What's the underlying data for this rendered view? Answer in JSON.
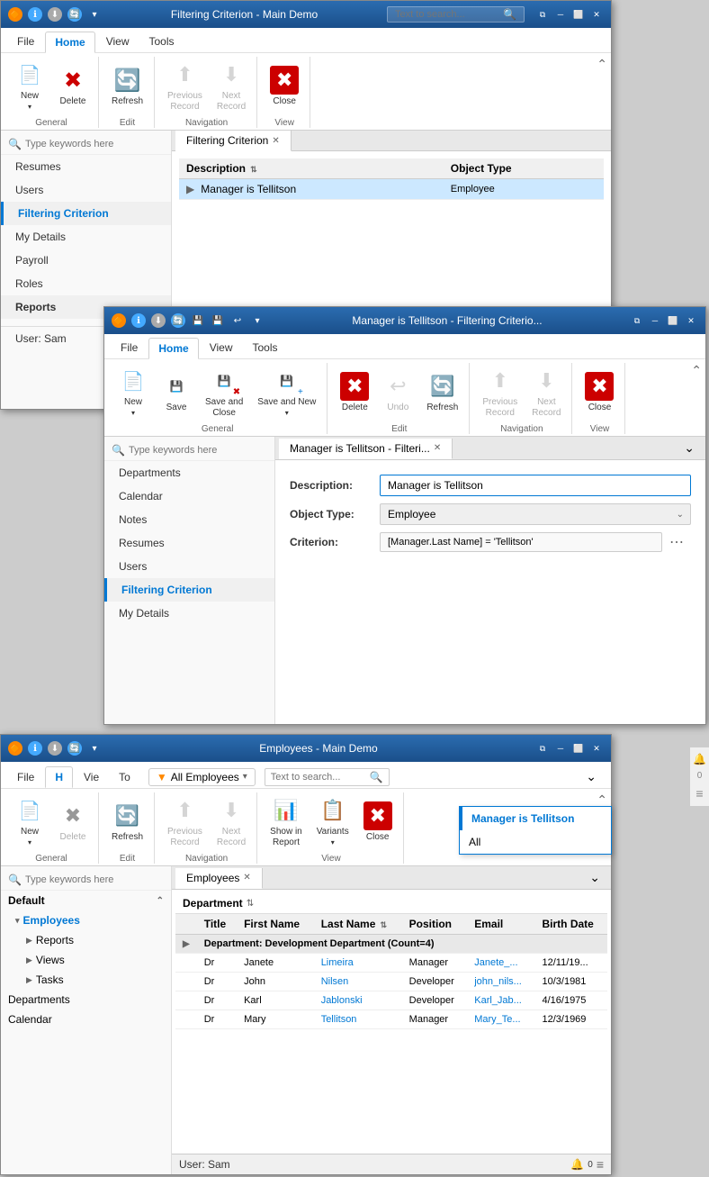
{
  "window1": {
    "title": "Filtering Criterion - Main Demo",
    "menu": [
      "File",
      "Home",
      "View",
      "Tools"
    ],
    "active_menu": "Home",
    "search_placeholder": "Text to search...",
    "ribbon": {
      "groups": [
        {
          "label": "General",
          "items": [
            {
              "id": "new",
              "label": "New",
              "icon": "📄",
              "disabled": false,
              "has_arrow": true
            },
            {
              "id": "delete",
              "label": "Delete",
              "icon": "✖",
              "icon_color": "red",
              "disabled": false
            }
          ]
        },
        {
          "label": "Edit",
          "items": [
            {
              "id": "refresh",
              "label": "Refresh",
              "icon": "🔄",
              "icon_color": "green",
              "disabled": false
            }
          ]
        },
        {
          "label": "Navigation",
          "items": [
            {
              "id": "prev-record",
              "label": "Previous Record",
              "icon": "⬆",
              "disabled": true
            },
            {
              "id": "next-record",
              "label": "Next Record",
              "icon": "⬇",
              "disabled": true
            }
          ]
        },
        {
          "label": "View",
          "items": [
            {
              "id": "close",
              "label": "Close",
              "icon": "✖",
              "icon_color": "red",
              "disabled": false
            }
          ]
        }
      ]
    },
    "sidebar": {
      "search_placeholder": "Type keywords here",
      "items": [
        {
          "label": "Resumes",
          "active": false
        },
        {
          "label": "Users",
          "active": false
        },
        {
          "label": "Filtering Criterion",
          "active": true
        },
        {
          "label": "My Details",
          "active": false
        },
        {
          "label": "Payroll",
          "active": false
        },
        {
          "label": "Roles",
          "active": false
        }
      ],
      "sections": [
        {
          "label": "Reports",
          "type": "header"
        },
        {
          "label": "User: Sam",
          "type": "footer"
        }
      ]
    },
    "tab": {
      "label": "Filtering Criterion",
      "closeable": true
    },
    "table": {
      "columns": [
        "Description",
        "Object Type"
      ],
      "rows": [
        {
          "description": "Manager is Tellitson",
          "object_type": "Employee",
          "selected": true
        }
      ]
    }
  },
  "window2": {
    "title": "Manager is Tellitson - Filtering Criterio...",
    "menu": [
      "File",
      "Home",
      "View",
      "Tools"
    ],
    "active_menu": "Home",
    "ribbon": {
      "groups": [
        {
          "label": "General",
          "items": [
            {
              "id": "new",
              "label": "New",
              "icon": "📄",
              "disabled": false,
              "has_arrow": true
            },
            {
              "id": "save",
              "label": "Save",
              "icon": "💾",
              "disabled": false
            },
            {
              "id": "save-close",
              "label": "Save and Close",
              "icon": "💾✖",
              "disabled": false
            },
            {
              "id": "save-new",
              "label": "Save and New",
              "icon": "💾+",
              "disabled": false,
              "has_arrow": true
            }
          ]
        },
        {
          "label": "Edit",
          "items": [
            {
              "id": "delete",
              "label": "Delete",
              "icon": "✖",
              "icon_color": "red",
              "disabled": false
            },
            {
              "id": "undo",
              "label": "Undo",
              "icon": "↩",
              "disabled": true
            },
            {
              "id": "refresh",
              "label": "Refresh",
              "icon": "🔄",
              "icon_color": "green",
              "disabled": false
            }
          ]
        },
        {
          "label": "Navigation",
          "items": [
            {
              "id": "prev-record",
              "label": "Previous Record",
              "icon": "⬆",
              "disabled": true
            },
            {
              "id": "next-record",
              "label": "Next Record",
              "icon": "⬇",
              "disabled": true
            }
          ]
        },
        {
          "label": "View",
          "items": [
            {
              "id": "close",
              "label": "Close",
              "icon": "✖",
              "icon_color": "red",
              "disabled": false
            }
          ]
        }
      ]
    },
    "sidebar": {
      "search_placeholder": "Type keywords here",
      "items": [
        {
          "label": "Departments",
          "active": false
        },
        {
          "label": "Calendar",
          "active": false
        },
        {
          "label": "Notes",
          "active": false
        },
        {
          "label": "Resumes",
          "active": false
        },
        {
          "label": "Users",
          "active": false
        },
        {
          "label": "Filtering Criterion",
          "active": true
        },
        {
          "label": "My Details",
          "active": false
        }
      ]
    },
    "tab": {
      "label": "Manager is Tellitson - Filteri...",
      "closeable": true
    },
    "form": {
      "description_label": "Description:",
      "description_value": "Manager is Tellitson",
      "object_type_label": "Object Type:",
      "object_type_value": "Employee",
      "criterion_label": "Criterion:",
      "criterion_value": "[Manager.Last Name] = 'Tellitson'"
    }
  },
  "window3": {
    "title": "Employees - Main Demo",
    "menu": [
      "File",
      "H",
      "Vie",
      "To"
    ],
    "active_menu": "H",
    "filter_label": "All Employees",
    "search_placeholder": "Text to search...",
    "ribbon": {
      "groups": [
        {
          "label": "General",
          "items": [
            {
              "id": "new",
              "label": "New",
              "icon": "📄",
              "disabled": false,
              "has_arrow": true
            },
            {
              "id": "delete",
              "label": "Delete",
              "icon": "✖",
              "icon_color": "red",
              "disabled": true
            }
          ]
        },
        {
          "label": "Edit",
          "items": [
            {
              "id": "refresh",
              "label": "Refresh",
              "icon": "🔄",
              "icon_color": "green",
              "disabled": false
            }
          ]
        },
        {
          "label": "Navigation",
          "items": [
            {
              "id": "prev-record",
              "label": "Previous Record",
              "icon": "⬆",
              "disabled": true
            },
            {
              "id": "next-record",
              "label": "Next Record",
              "icon": "⬇",
              "disabled": true
            }
          ]
        },
        {
          "label": "View",
          "items": [
            {
              "id": "show-report",
              "label": "Show in Report",
              "icon": "📊",
              "disabled": false
            },
            {
              "id": "variants",
              "label": "Variants",
              "icon": "📋",
              "disabled": false,
              "has_arrow": true
            },
            {
              "id": "close",
              "label": "Close",
              "icon": "✖",
              "icon_color": "red",
              "disabled": false
            }
          ]
        }
      ]
    },
    "sidebar": {
      "search_placeholder": "Type keywords here",
      "sections": [
        {
          "label": "Default",
          "expanded": true
        },
        {
          "label": "Employees",
          "indent": 1,
          "active": true,
          "has_arrow": true
        },
        {
          "label": "Reports",
          "indent": 2,
          "has_arrow": true
        },
        {
          "label": "Views",
          "indent": 2,
          "has_arrow": true
        },
        {
          "label": "Tasks",
          "indent": 2,
          "has_arrow": true
        },
        {
          "label": "Departments",
          "indent": 0
        },
        {
          "label": "Calendar",
          "indent": 0
        }
      ]
    },
    "tab": {
      "label": "Employees",
      "closeable": true
    },
    "table": {
      "department_column": "Department",
      "columns": [
        "Title",
        "First Name",
        "Last Name",
        "Position",
        "Email",
        "Birth Date"
      ],
      "groups": [
        {
          "name": "Department: Development Department (Count=4)",
          "rows": [
            {
              "title": "Dr",
              "first_name": "Janete",
              "last_name": "Limeira",
              "position": "Manager",
              "email": "Janete_...",
              "birth_date": "12/11/19..."
            },
            {
              "title": "Dr",
              "first_name": "John",
              "last_name": "Nilsen",
              "position": "Developer",
              "email": "john_nils...",
              "birth_date": "10/3/1981"
            },
            {
              "title": "Dr",
              "first_name": "Karl",
              "last_name": "Jablonski",
              "position": "Developer",
              "email": "Karl_Jab...",
              "birth_date": "4/16/1975"
            },
            {
              "title": "Dr",
              "first_name": "Mary",
              "last_name": "Tellitson",
              "position": "Manager",
              "email": "Mary_Te...",
              "birth_date": "12/3/1969"
            }
          ]
        }
      ]
    },
    "status": "User: Sam",
    "notification_count": "0"
  },
  "filter_dropdown": {
    "items": [
      {
        "label": "Manager is Tellitson",
        "active": true
      },
      {
        "label": "All",
        "active": false
      }
    ]
  },
  "icons": {
    "orange_dot": "🔶",
    "info": "ℹ",
    "arrow_down": "⬇",
    "refresh": "🔄",
    "pin": "📌",
    "settings": "⚙",
    "bell": "🔔",
    "menu": "≡"
  }
}
